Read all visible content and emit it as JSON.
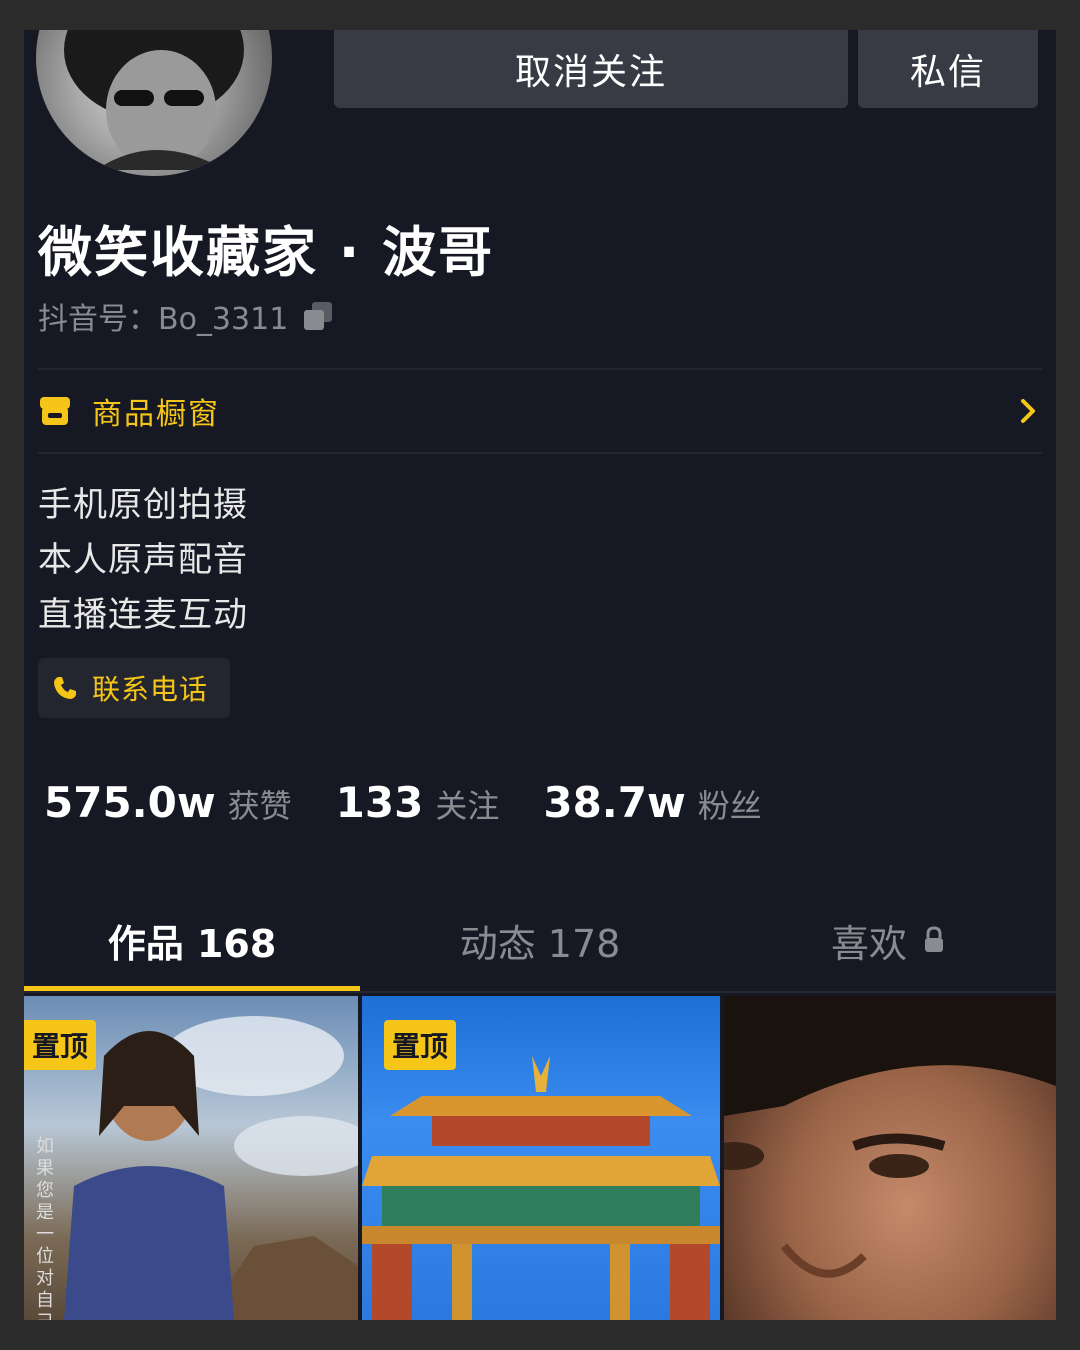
{
  "header": {
    "unfollow_label": "取消关注",
    "message_label": "私信"
  },
  "profile": {
    "name": "微笑收藏家 · 波哥",
    "douyin_id": "抖音号：Bo_3311"
  },
  "shop": {
    "label": "商品橱窗"
  },
  "bio": {
    "lines": [
      "手机原创拍摄",
      "本人原声配音",
      "直播连麦互动"
    ]
  },
  "contact": {
    "phone_label": "联系电话"
  },
  "stats": [
    {
      "value": "575.0w",
      "label": "获赞"
    },
    {
      "value": "133",
      "label": "关注"
    },
    {
      "value": "38.7w",
      "label": "粉丝"
    }
  ],
  "tabs": [
    {
      "label": "作品 168"
    },
    {
      "label": "动态 178"
    },
    {
      "label": "喜欢"
    }
  ],
  "videos": [
    {
      "badge": "置顶",
      "caption": "如果您是一位对自己外形"
    },
    {
      "badge": "置顶"
    },
    {}
  ],
  "colors": {
    "background": "#161823",
    "accent": "#f5c518",
    "button": "#393b44",
    "muted_text": "#8a8b91"
  },
  "icons": {
    "copy": "copy-icon",
    "shop": "shop-icon",
    "chevron": "chevron-right-icon",
    "phone": "phone-icon",
    "lock": "lock-icon"
  }
}
